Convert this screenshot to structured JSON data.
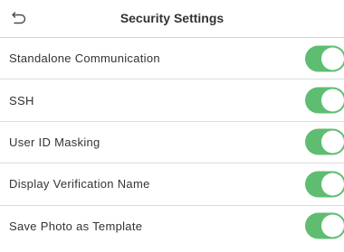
{
  "header": {
    "title": "Security Settings",
    "back_icon": "undo-arrow-icon"
  },
  "settings": [
    {
      "label": "Standalone Communication",
      "enabled": true
    },
    {
      "label": "SSH",
      "enabled": true
    },
    {
      "label": "User ID Masking",
      "enabled": true
    },
    {
      "label": "Display Verification Name",
      "enabled": true
    },
    {
      "label": "Save Photo as Template",
      "enabled": true
    }
  ],
  "colors": {
    "toggle_on": "#5fbd72",
    "divider": "#dcdcdc",
    "text": "#333333"
  }
}
